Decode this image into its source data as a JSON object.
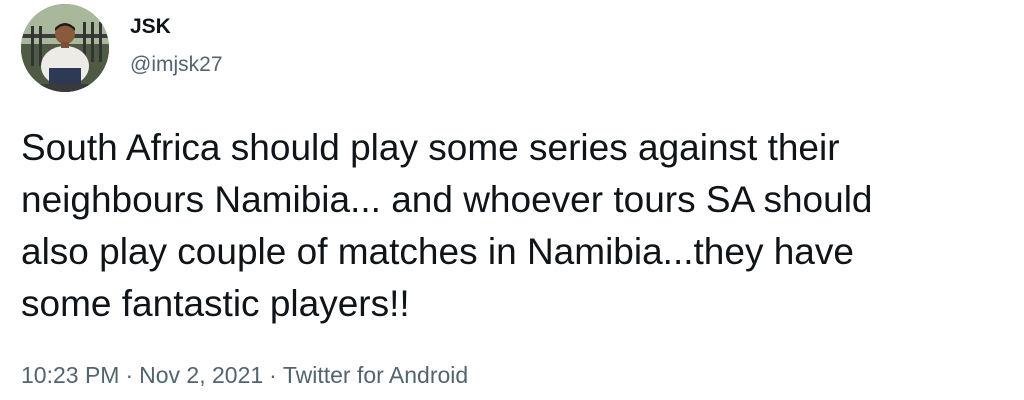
{
  "author": {
    "display_name": "JSK",
    "handle": "@imjsk27"
  },
  "tweet": {
    "text": "South Africa should play some series against their\nneighbours Namibia... and whoever tours SA should\nalso play couple of matches in Namibia...they have\nsome fantastic players!!"
  },
  "meta": {
    "time": "10:23 PM",
    "separator": "·",
    "date": "Nov 2, 2021",
    "source": "Twitter for Android"
  },
  "colors": {
    "text_primary": "#0f1419",
    "text_secondary": "#536471",
    "background": "#ffffff"
  }
}
